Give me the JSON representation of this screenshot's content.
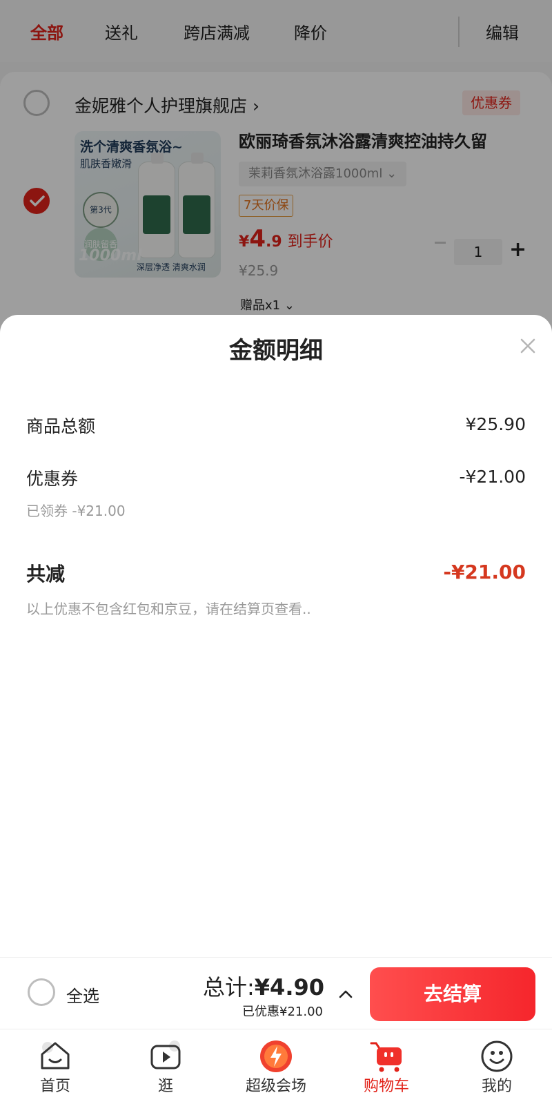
{
  "filters": {
    "tabs": [
      "全部",
      "送礼",
      "跨店满减",
      "降价"
    ],
    "edit_label": "编辑"
  },
  "store": {
    "name": "金妮雅个人护理旗舰店 ›",
    "coupon_label": "优惠券"
  },
  "product": {
    "title": "欧丽琦香氛沐浴露清爽控油持久留",
    "spec": "茉莉香氛沐浴露1000ml  ⌄",
    "guarantee": "7天价保",
    "price_yen": "¥",
    "price_int": "4",
    "price_dec": ".9",
    "price_tag": "到手价",
    "original_price": "¥25.9",
    "gift": "赠品x1 ⌄",
    "quantity": "1",
    "image_text": {
      "line1": "洗个清爽香氛浴~",
      "line2": "肌肤香嫩滑",
      "badge": "第3代",
      "badge2": "润肤留香",
      "big": "1000ml",
      "foot": "深层净透 清爽水润"
    }
  },
  "sheet": {
    "title": "金额明细",
    "rows": {
      "subtotal_label": "商品总额",
      "subtotal_value": "¥25.90",
      "coupon_label": "优惠券",
      "coupon_value": "-¥21.00",
      "coupon_sub": "已领券 -¥21.00",
      "total_label": "共减",
      "total_value": "-¥21.00",
      "note": "以上优惠不包含红包和京豆，请在结算页查看.."
    }
  },
  "checkout": {
    "select_all": "全选",
    "total_prefix": "总计:",
    "total_amount": "¥4.90",
    "saved": "已优惠¥21.00",
    "button": "去结算"
  },
  "tabbar": {
    "items": [
      {
        "label": "首页",
        "icon": "home-icon"
      },
      {
        "label": "逛",
        "icon": "video-play-icon"
      },
      {
        "label": "超级会场",
        "icon": "super-venue-icon"
      },
      {
        "label": "购物车",
        "icon": "cart-icon"
      },
      {
        "label": "我的",
        "icon": "smiley-profile-icon"
      }
    ],
    "active_index": 3
  },
  "colors": {
    "brand_red": "#e2231a",
    "discount_red": "#d5381f",
    "guarantee_orange": "#e2711c"
  }
}
